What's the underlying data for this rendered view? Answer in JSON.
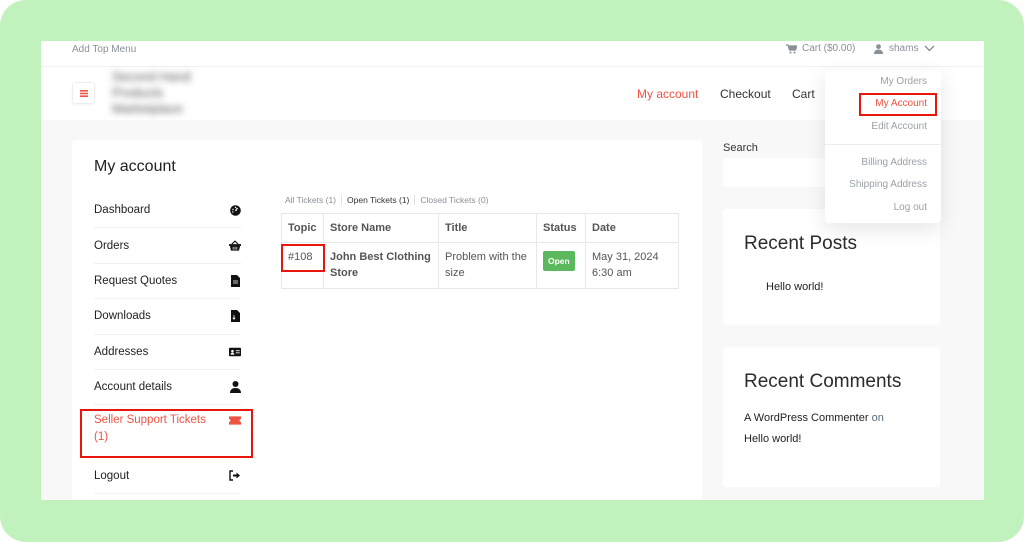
{
  "topbar": {
    "add_top_menu": "Add Top Menu",
    "cart_label": "Cart ($0.00)",
    "username": "shams"
  },
  "header": {
    "site_name": "Second Hand Products Marketplace",
    "nav": [
      "My account",
      "Checkout",
      "Cart"
    ],
    "active_nav": "My account"
  },
  "user_dropdown": {
    "items": [
      "My Orders",
      "My Account",
      "Edit Account",
      "Billing Address",
      "Shipping Address",
      "Log out"
    ],
    "active": "My Account"
  },
  "account": {
    "title": "My account",
    "menu": [
      {
        "label": "Dashboard",
        "icon": "dashboard-gauge-icon"
      },
      {
        "label": "Orders",
        "icon": "basket-icon"
      },
      {
        "label": "Request Quotes",
        "icon": "document-icon"
      },
      {
        "label": "Downloads",
        "icon": "file-download-icon"
      },
      {
        "label": "Addresses",
        "icon": "address-card-icon"
      },
      {
        "label": "Account details",
        "icon": "user-icon"
      },
      {
        "label": "Seller Support Tickets (1)",
        "icon": "ticket-icon",
        "active": true
      },
      {
        "label": "Logout",
        "icon": "sign-out-icon"
      }
    ]
  },
  "tickets": {
    "tabs": [
      "All Tickets (1)",
      "Open Tickets (1)",
      "Closed Tickets (0)"
    ],
    "active_tab": "Open Tickets (1)",
    "columns": [
      "Topic",
      "Store Name",
      "Title",
      "Status",
      "Date"
    ],
    "rows": [
      {
        "topic": "#108",
        "store": "John Best Clothing Store",
        "title": "Problem with the size",
        "status": "Open",
        "date": "May 31, 2024 6:30 am"
      }
    ]
  },
  "sidebar": {
    "search_label": "Search",
    "search_value": "",
    "recent_posts_title": "Recent Posts",
    "recent_posts": [
      "Hello world!"
    ],
    "recent_comments_title": "Recent Comments",
    "recent_comments": [
      {
        "author": "A WordPress Commenter",
        "connector": "on",
        "post": "Hello world!"
      }
    ]
  },
  "colors": {
    "accent": "#ef5344",
    "highlight_box": "#e8160c",
    "status_open": "#5cb85c",
    "outer_background": "#c1f2bd"
  }
}
